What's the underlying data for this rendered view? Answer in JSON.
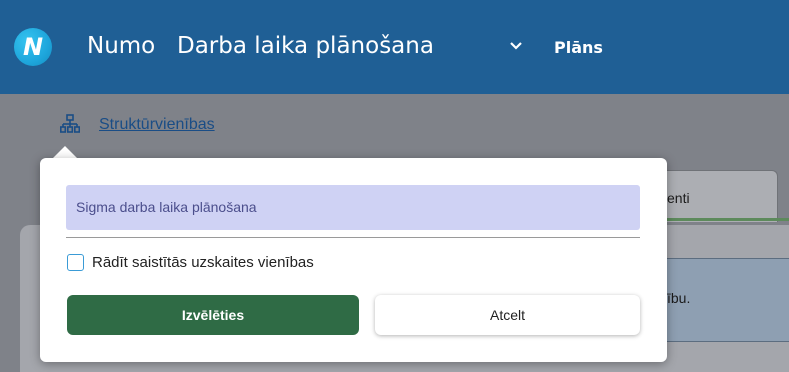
{
  "header": {
    "logo_letter": "N",
    "brand": "Numo",
    "module": "Darba laika plānošana",
    "nav_plans": "Plāns"
  },
  "breadcrumb": {
    "label": "Struktūrvienības"
  },
  "background": {
    "tab_label": "enti",
    "info_text": "ību."
  },
  "popup": {
    "selected_unit": "Sigma darba laika plānošana",
    "checkbox_label": "Rādīt saistītās uzskaites vienības",
    "checkbox_checked": false,
    "select_button": "Izvēlēties",
    "cancel_button": "Atcelt"
  },
  "colors": {
    "header_bg": "#1f5f95",
    "primary_button": "#2f6b45",
    "selected_bg": "#cfd2f4",
    "checkbox_border": "#3a9bd6"
  }
}
